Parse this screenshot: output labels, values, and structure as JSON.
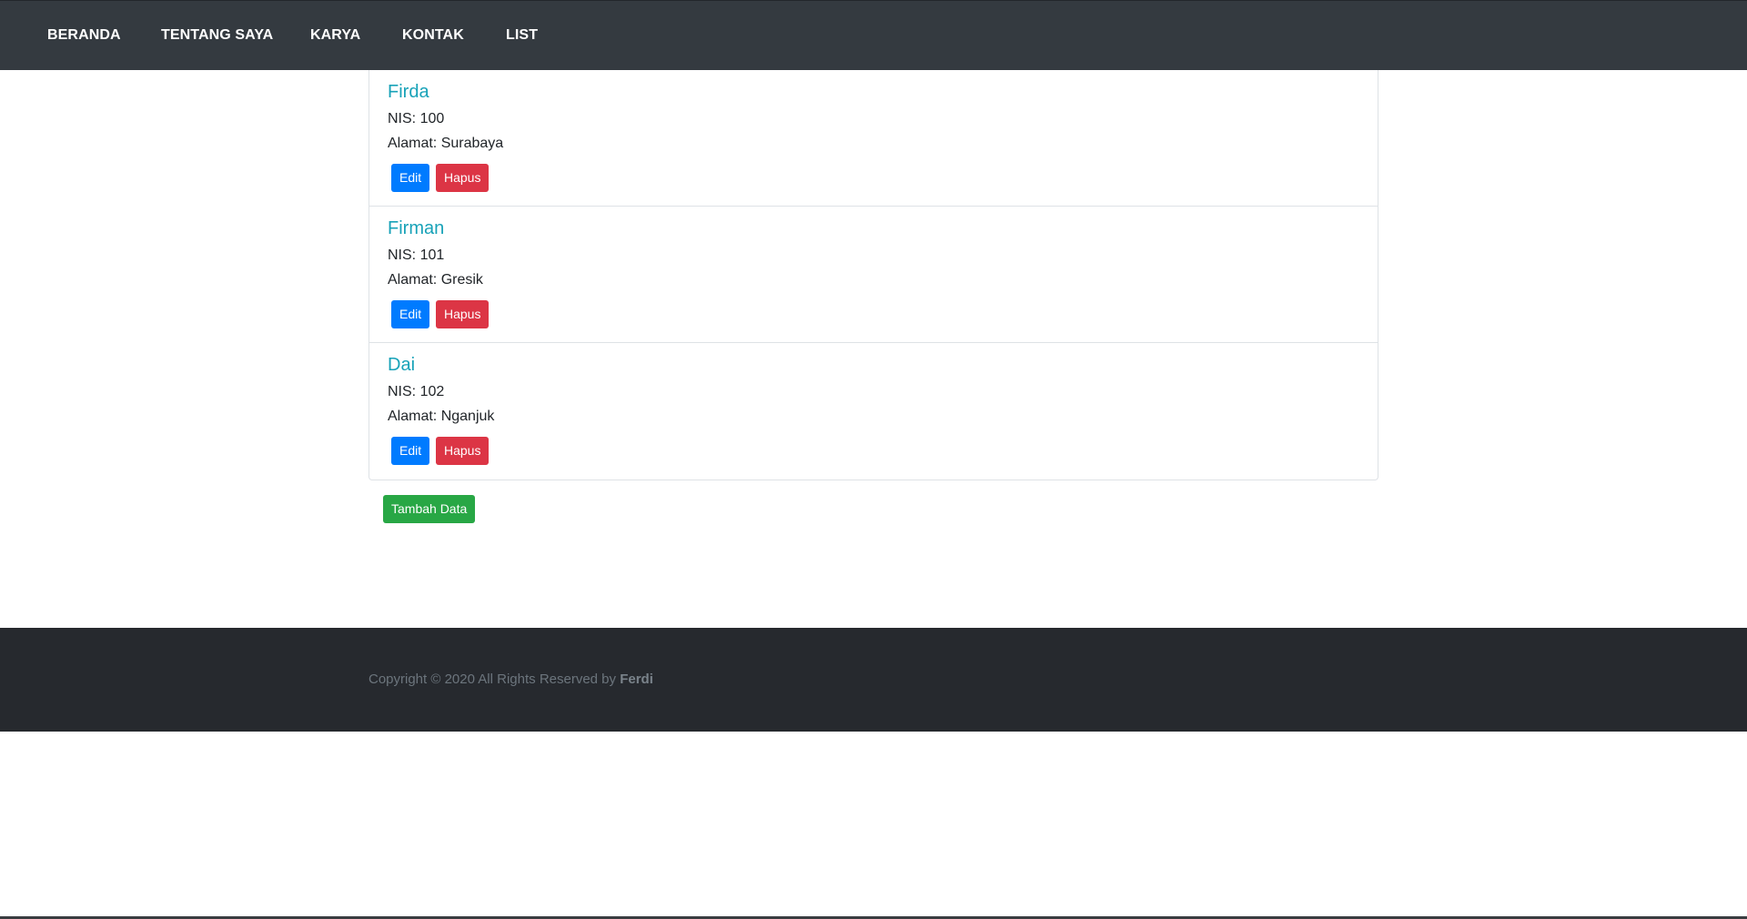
{
  "nav": {
    "items": [
      {
        "label": "BERANDA"
      },
      {
        "label": "TENTANG SAYA"
      },
      {
        "label": "KARYA"
      },
      {
        "label": "KONTAK"
      },
      {
        "label": "LIST"
      }
    ]
  },
  "students": [
    {
      "name": "Firda",
      "nis": "NIS: 100",
      "alamat": "Alamat: Surabaya",
      "edit_label": "Edit",
      "delete_label": "Hapus"
    },
    {
      "name": "Firman",
      "nis": "NIS: 101",
      "alamat": "Alamat: Gresik",
      "edit_label": "Edit",
      "delete_label": "Hapus"
    },
    {
      "name": "Dai",
      "nis": "NIS: 102",
      "alamat": "Alamat: Nganjuk",
      "edit_label": "Edit",
      "delete_label": "Hapus"
    }
  ],
  "actions": {
    "add_label": "Tambah Data"
  },
  "footer": {
    "copyright_prefix": "Copyright © 2020 All Rights Reserved by ",
    "author": "Ferdi"
  },
  "colors": {
    "navbar": "#343a40",
    "footer": "#26292e",
    "title": "#17a2b8",
    "edit": "#007bff",
    "delete": "#dc3545",
    "add": "#28a745"
  }
}
